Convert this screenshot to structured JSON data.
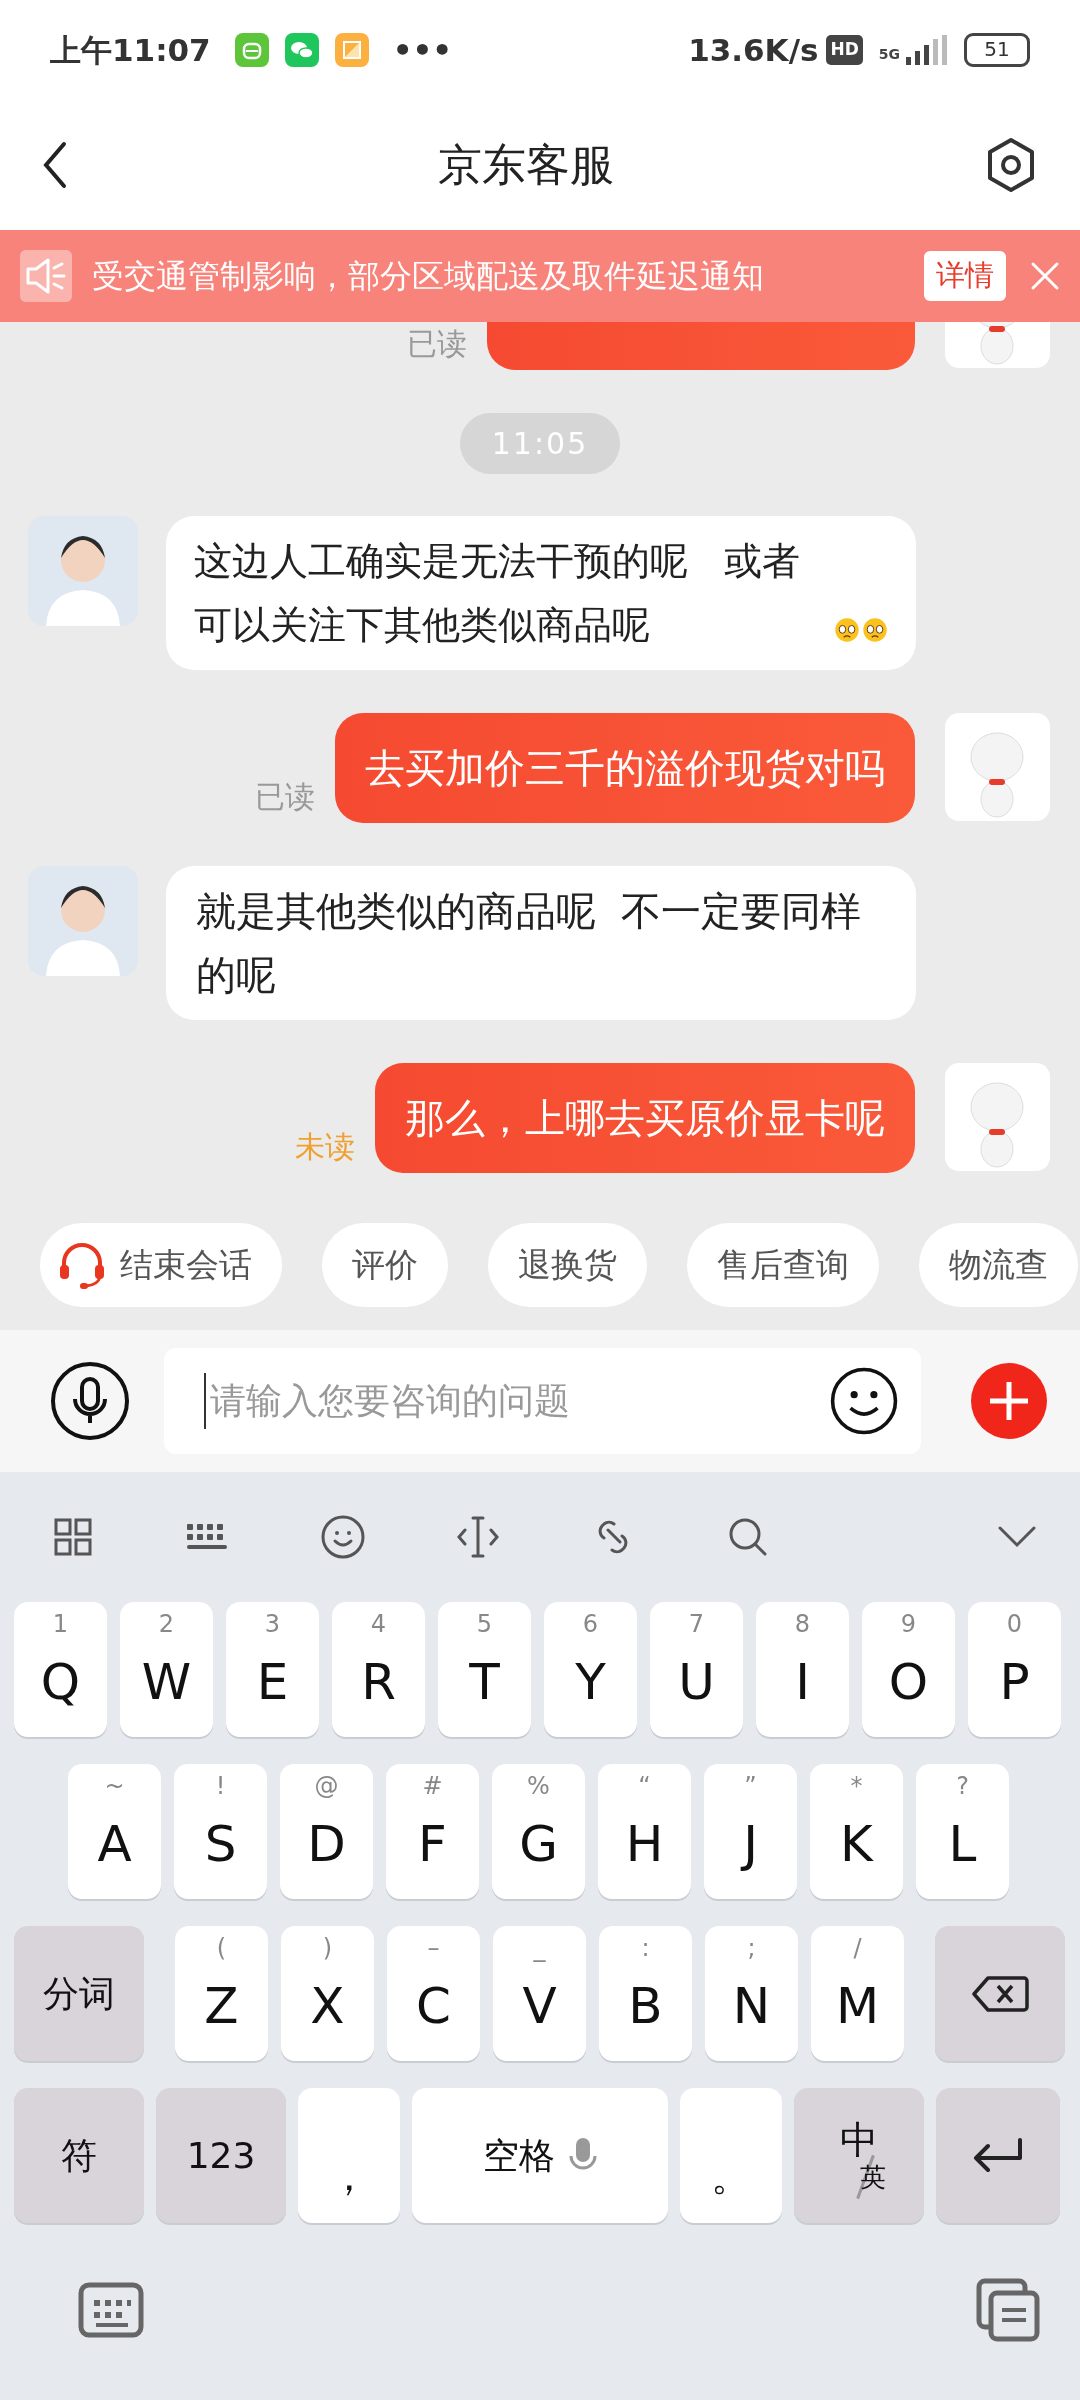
{
  "status_bar": {
    "time": "上午11:07",
    "more": "•••",
    "speed": "13.6K/s",
    "hd": "HD",
    "network": "5G",
    "battery": "51"
  },
  "header": {
    "title": "京东客服"
  },
  "notice": {
    "text": "受交通管制影响，部分区域配送及取件延迟通知",
    "button": "详情"
  },
  "cut_message": {
    "read_status": "已读",
    "read": true
  },
  "time_divider": "11:05",
  "messages": [
    {
      "outgoing": false,
      "kind": "text_emoji",
      "text": "这边人工确实是无法干预的呢   或者可以关注下其他类似商品呢"
    },
    {
      "outgoing": true,
      "kind": "text",
      "text": "去买加价三千的溢价现货对吗",
      "read_status": "已读",
      "read": true
    },
    {
      "outgoing": false,
      "kind": "text",
      "text": "就是其他类似的商品呢  不一定要同样的呢"
    },
    {
      "outgoing": true,
      "kind": "text",
      "text": "那么，上哪去买原价显卡呢",
      "read_status": "未读",
      "read": false
    }
  ],
  "quick_replies": [
    {
      "label": "结束会话",
      "kind": "icon"
    },
    {
      "label": "评价",
      "kind": "plain"
    },
    {
      "label": "退换货",
      "kind": "plain"
    },
    {
      "label": "售后查询",
      "kind": "plain"
    },
    {
      "label": "物流查",
      "kind": "plain"
    }
  ],
  "input": {
    "placeholder": "请输入您要咨询的问题"
  },
  "keyboard": {
    "rows": [
      {
        "keys": [
          {
            "kind": "letter",
            "hint": "1",
            "label": "Q"
          },
          {
            "kind": "letter",
            "hint": "2",
            "label": "W"
          },
          {
            "kind": "letter",
            "hint": "3",
            "label": "E"
          },
          {
            "kind": "letter",
            "hint": "4",
            "label": "R"
          },
          {
            "kind": "letter",
            "hint": "5",
            "label": "T"
          },
          {
            "kind": "letter",
            "hint": "6",
            "label": "Y"
          },
          {
            "kind": "letter",
            "hint": "7",
            "label": "U"
          },
          {
            "kind": "letter",
            "hint": "8",
            "label": "I"
          },
          {
            "kind": "letter",
            "hint": "9",
            "label": "O"
          },
          {
            "kind": "letter",
            "hint": "0",
            "label": "P"
          }
        ]
      },
      {
        "keys": [
          {
            "kind": "letter",
            "hint": "~",
            "label": "A"
          },
          {
            "kind": "letter",
            "hint": "!",
            "label": "S"
          },
          {
            "kind": "letter",
            "hint": "@",
            "label": "D"
          },
          {
            "kind": "letter",
            "hint": "#",
            "label": "F"
          },
          {
            "kind": "letter",
            "hint": "%",
            "label": "G"
          },
          {
            "kind": "letter",
            "hint": "“",
            "label": "H"
          },
          {
            "kind": "letter",
            "hint": "”",
            "label": "J"
          },
          {
            "kind": "letter",
            "hint": "*",
            "label": "K"
          },
          {
            "kind": "letter",
            "hint": "?",
            "label": "L"
          }
        ]
      },
      {
        "keys": [
          {
            "kind": "function",
            "label": "分词"
          },
          {
            "kind": "letter",
            "hint": "(",
            "label": "Z"
          },
          {
            "kind": "letter",
            "hint": ")",
            "label": "X"
          },
          {
            "kind": "letter",
            "hint": "–",
            "label": "C"
          },
          {
            "kind": "letter",
            "hint": "_",
            "label": "V"
          },
          {
            "kind": "letter",
            "hint": ":",
            "label": "B"
          },
          {
            "kind": "letter",
            "hint": ";",
            "label": "N"
          },
          {
            "kind": "letter",
            "hint": "/",
            "label": "M"
          },
          {
            "kind": "backspace"
          }
        ]
      },
      {
        "keys": [
          {
            "kind": "function",
            "label": "符"
          },
          {
            "kind": "function",
            "label": "123"
          },
          {
            "kind": "punct",
            "label": "，"
          },
          {
            "kind": "space",
            "label": "空格"
          },
          {
            "kind": "punct",
            "label": "。"
          },
          {
            "kind": "lang",
            "label": "中",
            "sub": "英"
          },
          {
            "kind": "enter"
          }
        ]
      }
    ]
  }
}
